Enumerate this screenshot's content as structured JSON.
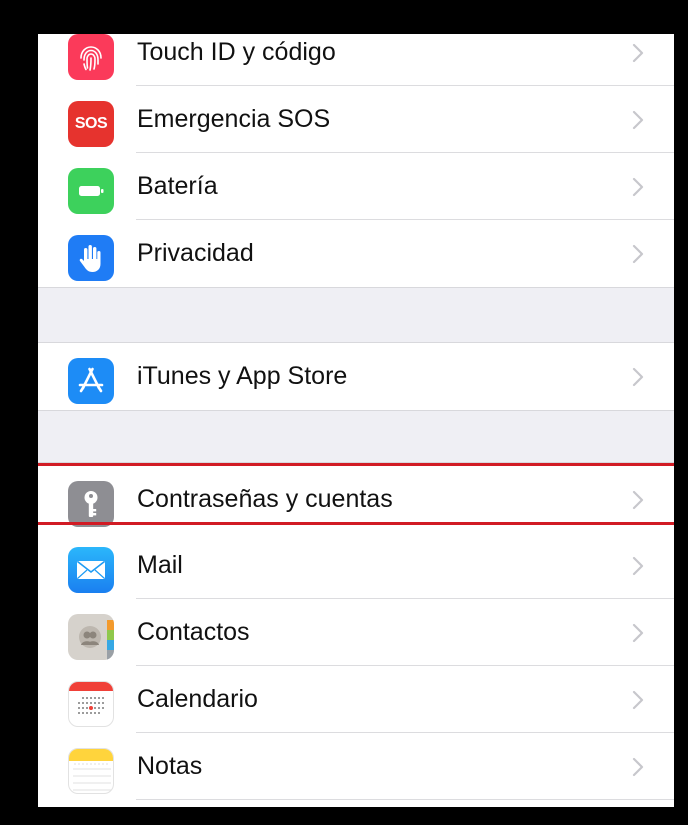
{
  "settings": {
    "group1": [
      {
        "label": "Touch ID y código",
        "icon": "fingerprint-icon",
        "color": "#fb3a5a"
      },
      {
        "label": "Emergencia SOS",
        "icon": "sos-icon",
        "icon_text": "SOS",
        "color": "#e6332e"
      },
      {
        "label": "Batería",
        "icon": "battery-icon",
        "color": "#3dd15c"
      },
      {
        "label": "Privacidad",
        "icon": "hand-icon",
        "color": "#1f7cf5"
      }
    ],
    "group2": [
      {
        "label": "iTunes y App Store",
        "icon": "app-store-icon",
        "color": "#1d8cf6"
      }
    ],
    "group3": [
      {
        "label": "Contraseñas y cuentas",
        "icon": "key-icon",
        "color": "#8e8e93",
        "highlighted": true
      },
      {
        "label": "Mail",
        "icon": "mail-icon",
        "color": "#1e9cf4"
      },
      {
        "label": "Contactos",
        "icon": "contacts-icon",
        "color": "#c8c3bd"
      },
      {
        "label": "Calendario",
        "icon": "calendar-icon",
        "color": "#ffffff"
      },
      {
        "label": "Notas",
        "icon": "notes-icon",
        "color": "#ffd43c"
      }
    ]
  },
  "colors": {
    "highlight": "#d11b24",
    "group_background": "#efeff4",
    "chevron": "#c7c7cc"
  }
}
